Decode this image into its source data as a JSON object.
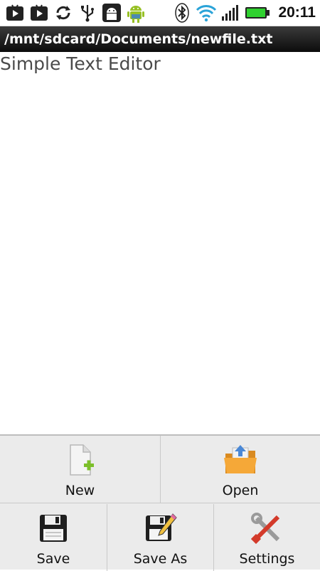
{
  "status_bar": {
    "icons": [
      "play-store-icon",
      "play-store-icon",
      "sync-icon",
      "usb-icon",
      "android-debug-icon",
      "android-icon",
      "bluetooth-icon",
      "wifi-icon",
      "signal-icon",
      "battery-icon"
    ],
    "time": "20:11",
    "colors": {
      "wifi": "#2aa3d8",
      "battery": "#2fd12f"
    }
  },
  "title_bar": {
    "path": "/mnt/sdcard/Documents/newfile.txt"
  },
  "editor": {
    "text": "Simple Text Editor"
  },
  "options_menu": {
    "items": [
      {
        "label": "New",
        "icon": "new-file-icon"
      },
      {
        "label": "Open",
        "icon": "open-folder-icon"
      },
      {
        "label": "Save",
        "icon": "save-icon"
      },
      {
        "label": "Save As",
        "icon": "save-as-icon"
      },
      {
        "label": "Settings",
        "icon": "settings-icon"
      }
    ]
  }
}
